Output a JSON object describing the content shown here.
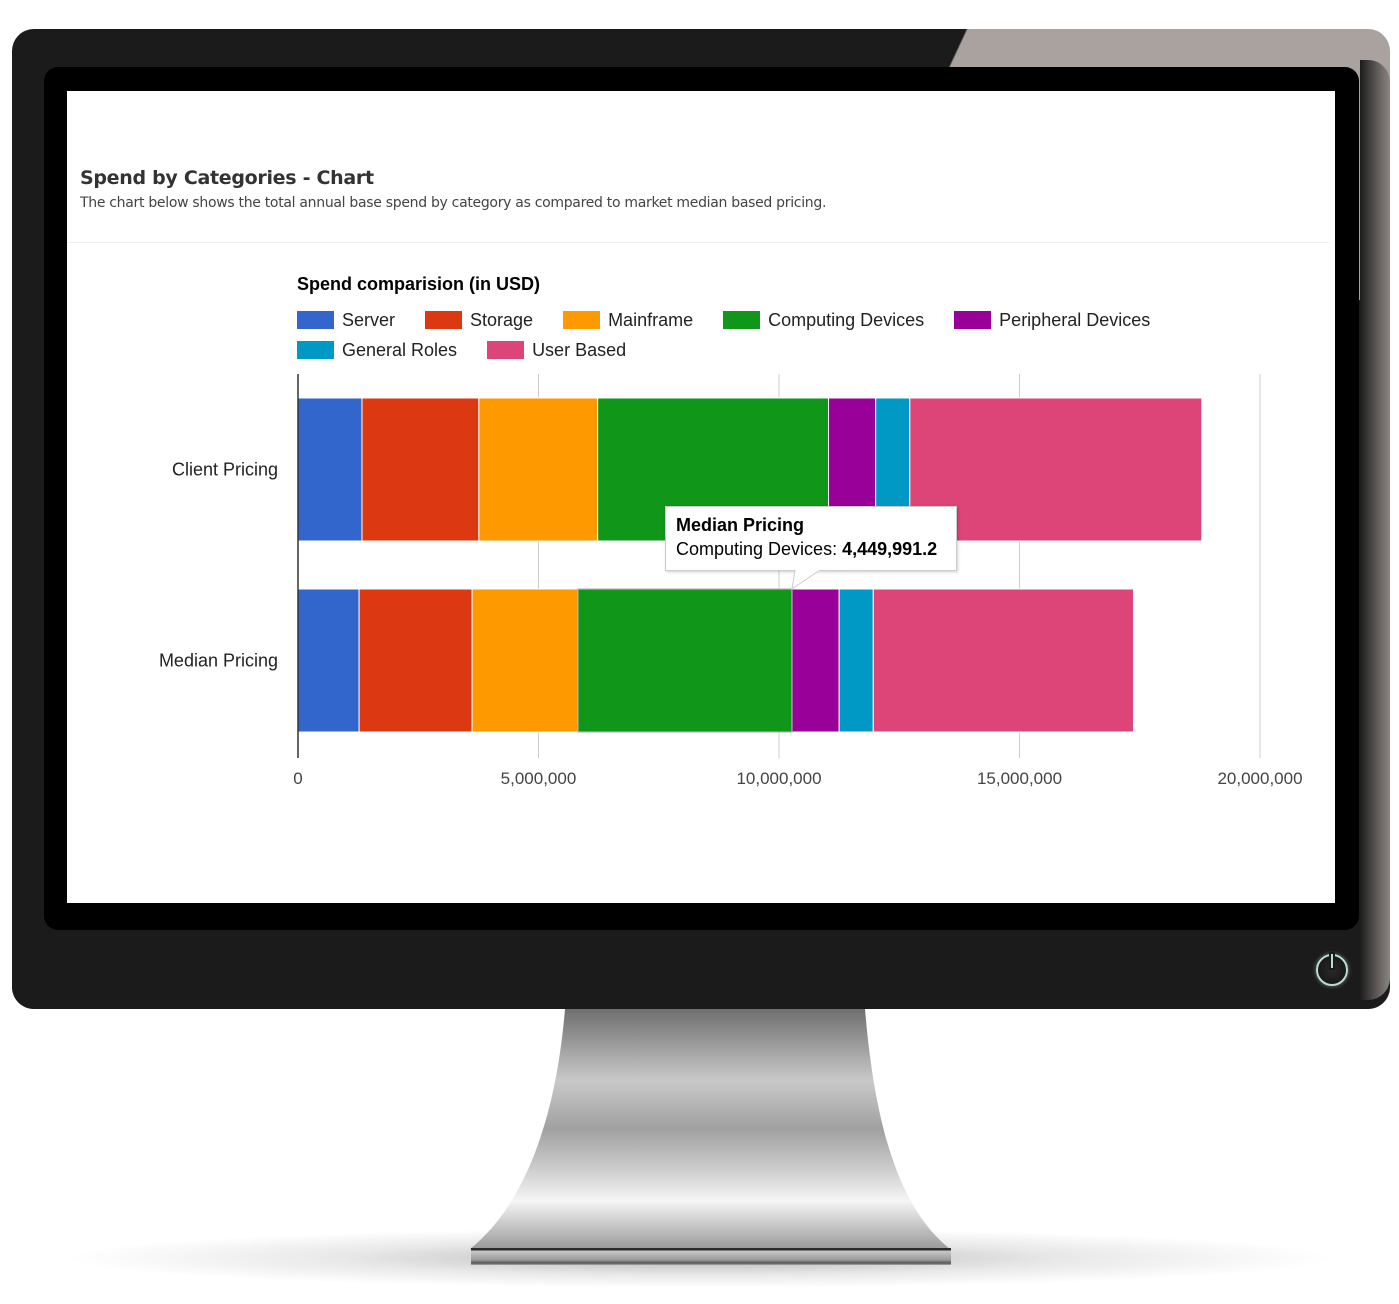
{
  "panel": {
    "title": "Spend by Categories - Chart",
    "subtitle": "The chart below shows the total annual base spend by category as compared to market median based pricing."
  },
  "tooltip": {
    "title": "Median Pricing",
    "label": "Computing Devices: ",
    "value": "4,449,991.2"
  },
  "chart_data": {
    "type": "bar",
    "orientation": "horizontal",
    "stacked": true,
    "title": "Spend comparision (in USD)",
    "xlabel": "",
    "ylabel": "",
    "xlim": [
      0,
      20000000
    ],
    "xticks": [
      0,
      5000000,
      10000000,
      15000000,
      20000000
    ],
    "xtick_labels": [
      "0",
      "5,000,000",
      "10,000,000",
      "15,000,000",
      "20,000,000"
    ],
    "grid": true,
    "legend_position": "top",
    "categories": [
      "Client Pricing",
      "Median Pricing"
    ],
    "series": [
      {
        "name": "Server",
        "color": "#3366cc",
        "values": [
          1330000,
          1270000
        ]
      },
      {
        "name": "Storage",
        "color": "#dc3912",
        "values": [
          2430000,
          2350000
        ]
      },
      {
        "name": "Mainframe",
        "color": "#ff9900",
        "values": [
          2470000,
          2200000
        ]
      },
      {
        "name": "Computing Devices",
        "color": "#109618",
        "values": [
          4800000,
          4449991.2
        ]
      },
      {
        "name": "Peripheral Devices",
        "color": "#990099",
        "values": [
          980000,
          980000
        ]
      },
      {
        "name": "General Roles",
        "color": "#0099c6",
        "values": [
          710000,
          710000
        ]
      },
      {
        "name": "User Based",
        "color": "#dd4477",
        "values": [
          6070000,
          5410000
        ]
      }
    ]
  },
  "device": {
    "power_button": "power-icon"
  }
}
